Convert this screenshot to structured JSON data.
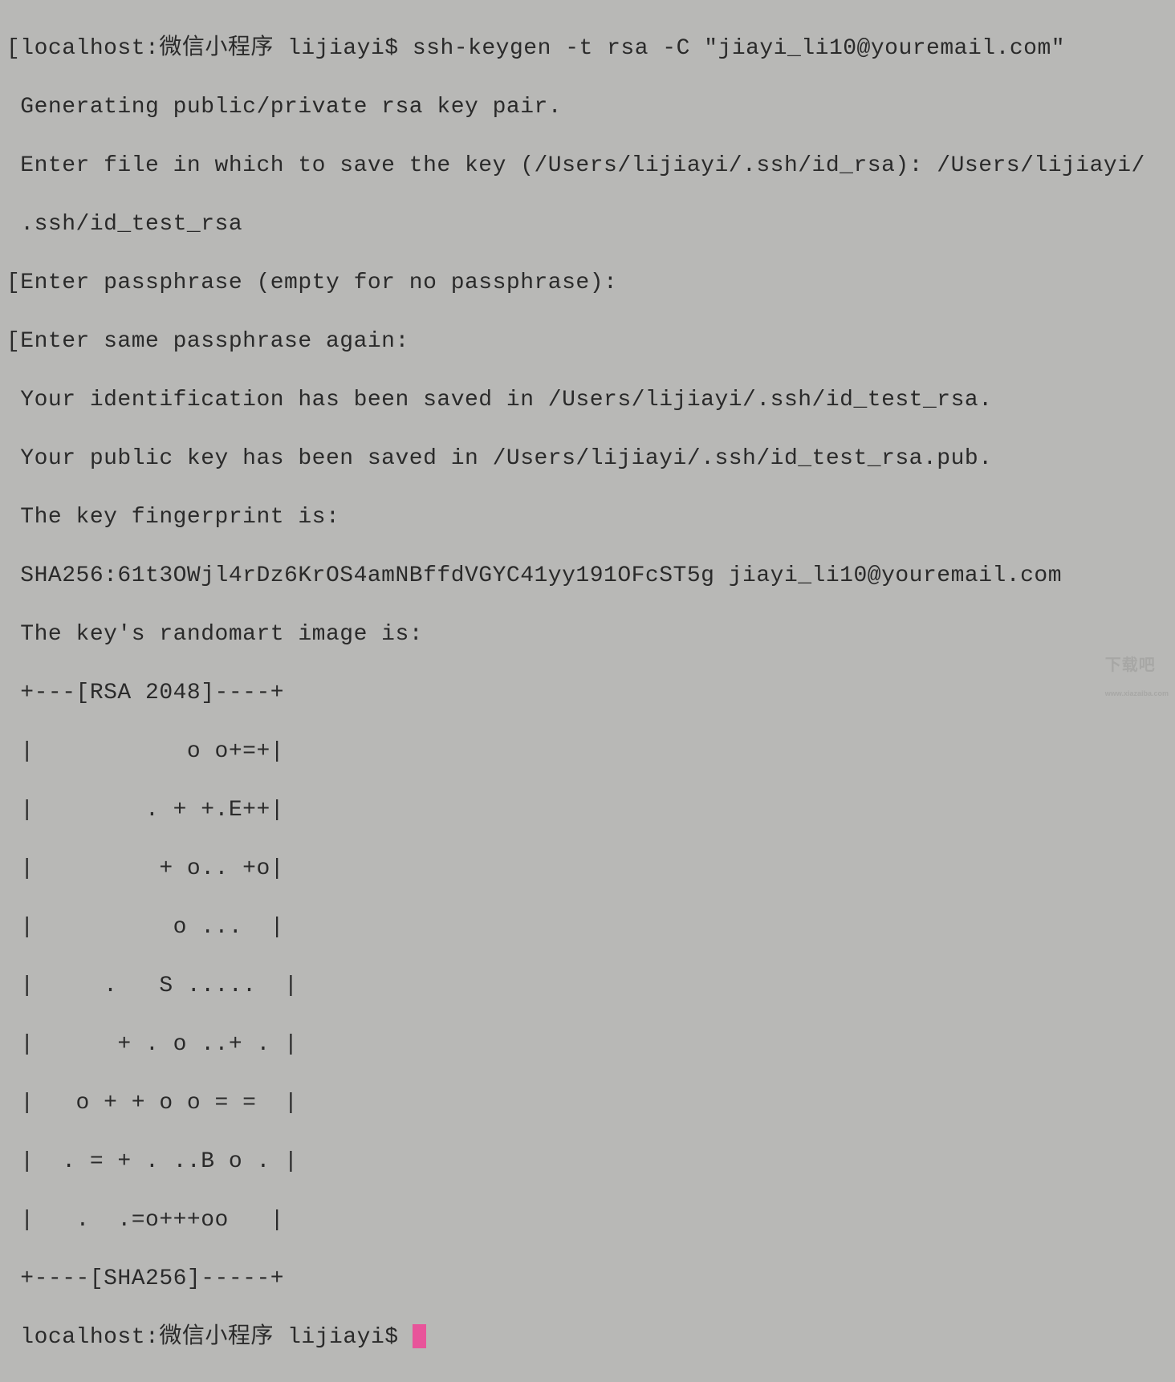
{
  "terminal": {
    "lines": {
      "l0": "[localhost:微信小程序 lijiayi$ ssh-keygen -t rsa -C \"jiayi_li10@youremail.com\"",
      "l1": " Generating public/private rsa key pair.",
      "l2": " Enter file in which to save the key (/Users/lijiayi/.ssh/id_rsa): /Users/lijiayi/",
      "l3": " .ssh/id_test_rsa",
      "l4": "[Enter passphrase (empty for no passphrase):",
      "l5": "[Enter same passphrase again:",
      "l6": " Your identification has been saved in /Users/lijiayi/.ssh/id_test_rsa.",
      "l7": " Your public key has been saved in /Users/lijiayi/.ssh/id_test_rsa.pub.",
      "l8": " The key fingerprint is:",
      "l9": " SHA256:61t3OWjl4rDz6KrOS4amNBffdVGYC41yy191OFcST5g jiayi_li10@youremail.com",
      "l10": " The key's randomart image is:",
      "l11": " +---[RSA 2048]----+",
      "l12": " |           o o+=+|",
      "l13": " |        . + +.E++|",
      "l14": " |         + o.. +o|",
      "l15": " |          o ...  |",
      "l16": " |     .   S .....  |",
      "l17": " |      + . o ..+ . |",
      "l18": " |   o + + o o = =  |",
      "l19": " |  . = + . ..B o . |",
      "l20": " |   .  .=o+++oo   |",
      "l21": " +----[SHA256]-----+",
      "l22_prompt": " localhost:微信小程序 lijiayi$ "
    }
  },
  "watermark": {
    "main": "下载吧",
    "sub": "www.xiazaiba.com"
  }
}
